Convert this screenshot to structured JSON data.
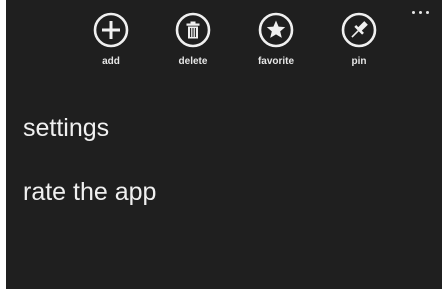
{
  "app_bar": {
    "buttons": [
      {
        "label": "add",
        "icon": "plus-icon"
      },
      {
        "label": "delete",
        "icon": "trash-icon"
      },
      {
        "label": "favorite",
        "icon": "star-icon"
      },
      {
        "label": "pin",
        "icon": "pin-icon"
      }
    ],
    "more_icon": "ellipsis-icon"
  },
  "menu": {
    "items": [
      {
        "label": "settings"
      },
      {
        "label": "rate the app"
      }
    ]
  },
  "colors": {
    "background": "#1f1f1f",
    "foreground": "#f0f0f0"
  }
}
